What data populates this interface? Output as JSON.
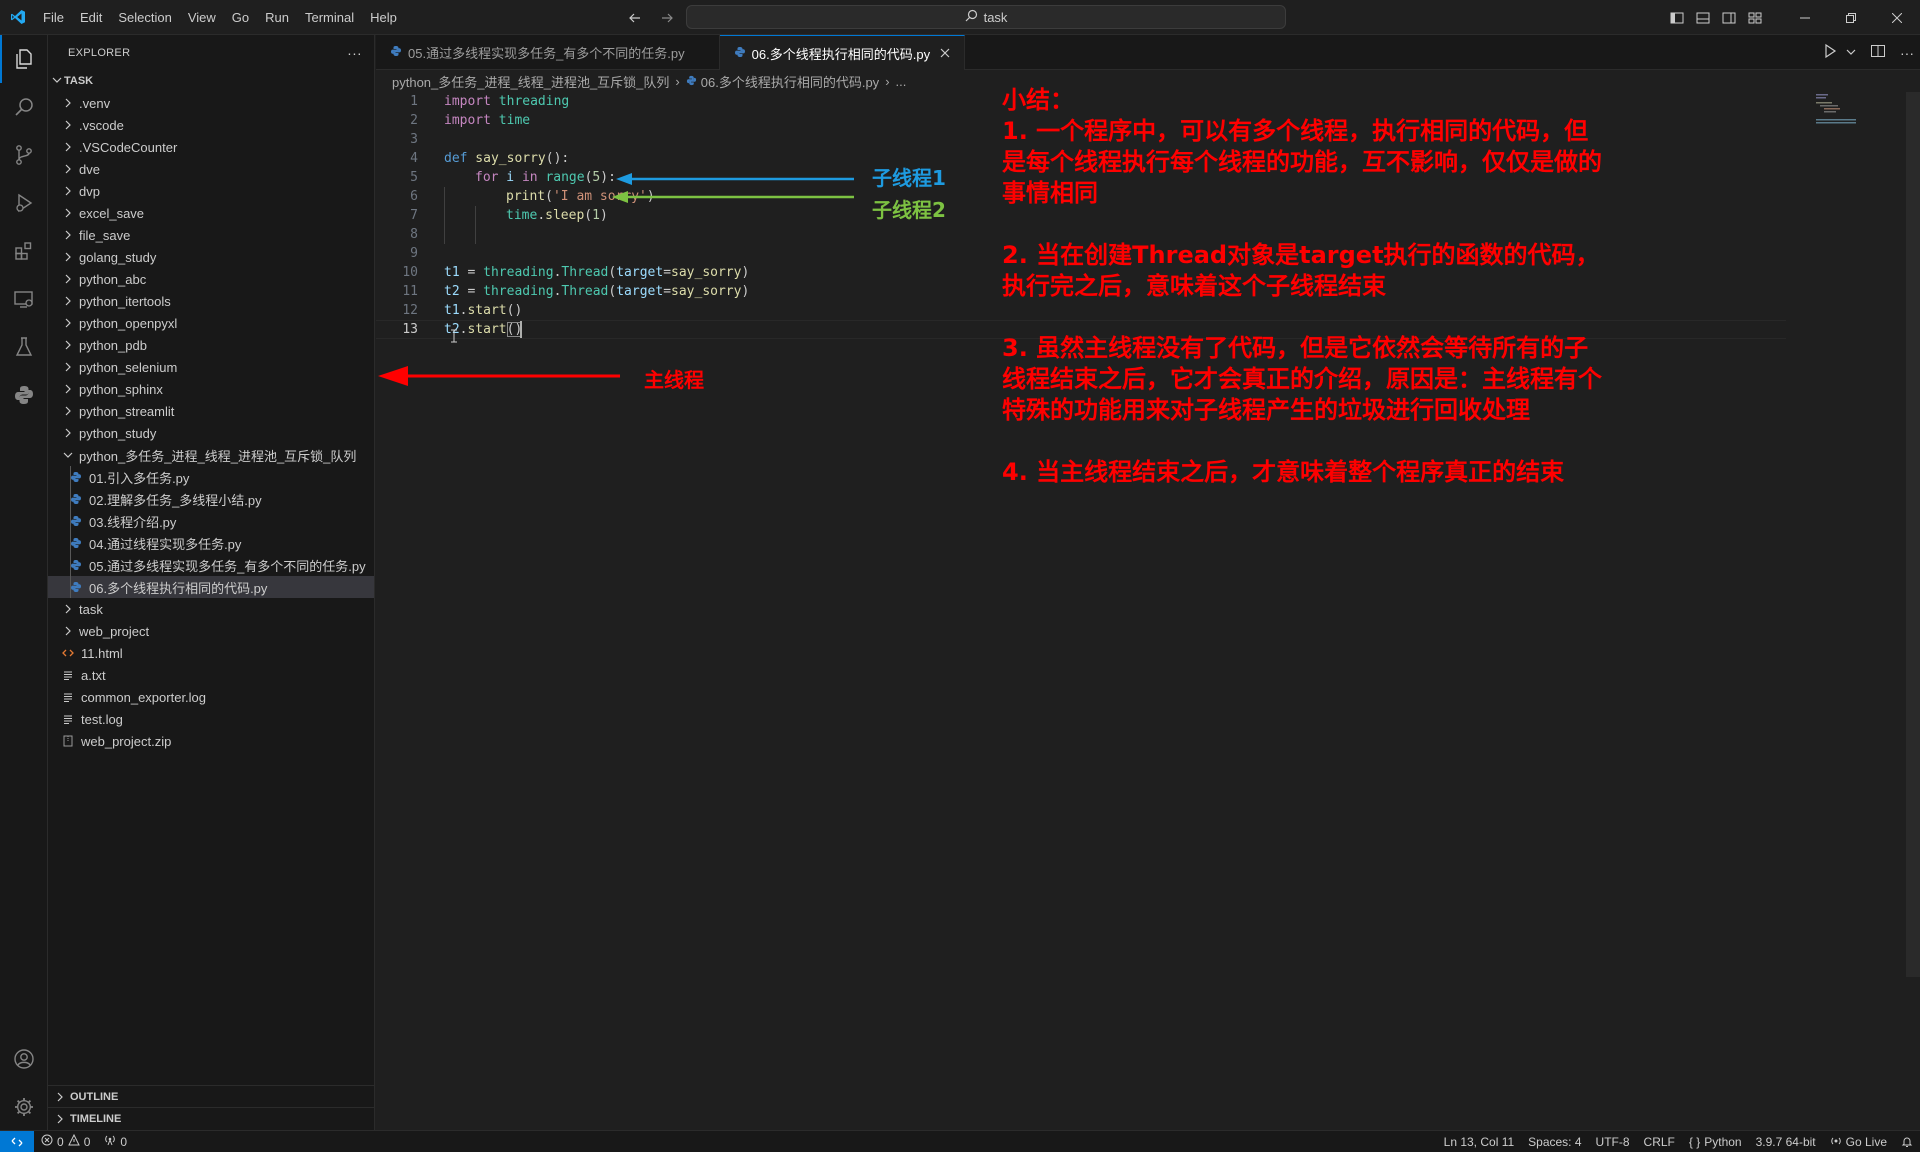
{
  "menu": [
    "File",
    "Edit",
    "Selection",
    "View",
    "Go",
    "Run",
    "Terminal",
    "Help"
  ],
  "search": {
    "text": "task"
  },
  "explorer": {
    "title": "EXPLORER",
    "more": "···",
    "folder": "TASK",
    "items": [
      {
        "label": ".venv",
        "kind": "folder"
      },
      {
        "label": ".vscode",
        "kind": "folder"
      },
      {
        "label": ".VSCodeCounter",
        "kind": "folder"
      },
      {
        "label": "dve",
        "kind": "folder"
      },
      {
        "label": "dvp",
        "kind": "folder"
      },
      {
        "label": "excel_save",
        "kind": "folder"
      },
      {
        "label": "file_save",
        "kind": "folder"
      },
      {
        "label": "golang_study",
        "kind": "folder"
      },
      {
        "label": "python_abc",
        "kind": "folder"
      },
      {
        "label": "python_itertools",
        "kind": "folder"
      },
      {
        "label": "python_openpyxl",
        "kind": "folder"
      },
      {
        "label": "python_pdb",
        "kind": "folder"
      },
      {
        "label": "python_selenium",
        "kind": "folder"
      },
      {
        "label": "python_sphinx",
        "kind": "folder"
      },
      {
        "label": "python_streamlit",
        "kind": "folder"
      },
      {
        "label": "python_study",
        "kind": "folder"
      },
      {
        "label": "python_多任务_进程_线程_进程池_互斥锁_队列",
        "kind": "open-folder"
      }
    ],
    "children": [
      "01.引入多任务.py",
      "02.理解多任务_多线程小结.py",
      "03.线程介绍.py",
      "04.通过线程实现多任务.py",
      "05.通过多线程实现多任务_有多个不同的任务.py",
      "06.多个线程执行相同的代码.py"
    ],
    "after": [
      {
        "label": "task",
        "kind": "folder"
      },
      {
        "label": "web_project",
        "kind": "folder"
      },
      {
        "label": "11.html",
        "kind": "html"
      },
      {
        "label": "a.txt",
        "kind": "text"
      },
      {
        "label": "common_exporter.log",
        "kind": "text"
      },
      {
        "label": "test.log",
        "kind": "text"
      },
      {
        "label": "web_project.zip",
        "kind": "zip"
      }
    ],
    "outline": "OUTLINE",
    "timeline": "TIMELINE"
  },
  "tabs": [
    {
      "label": "05.通过多线程实现多任务_有多个不同的任务.py",
      "active": false
    },
    {
      "label": "06.多个线程执行相同的代码.py",
      "active": true
    }
  ],
  "breadcrumb": {
    "folder": "python_多任务_进程_线程_进程池_互斥锁_队列",
    "file": "06.多个线程执行相同的代码.py",
    "more": "..."
  },
  "code": {
    "line_numbers": [
      "1",
      "2",
      "3",
      "4",
      "5",
      "6",
      "7",
      "8",
      "9",
      "10",
      "11",
      "12",
      "13"
    ],
    "lines": {
      "l1a": "import",
      "l1b": " threading",
      "l2a": "import",
      "l2b": " time",
      "l4a": "def",
      "l4b": " say_sorry",
      "l4c": "():",
      "l5a": "for",
      "l5b": " i ",
      "l5c": "in",
      "l5d": " range",
      "l5e": "(",
      "l5f": "5",
      "l5g": "):",
      "l6a": "print",
      "l6b": "(",
      "l6c": "'I am sorry'",
      "l6d": ")",
      "l7a": "time",
      "l7b": ".",
      "l7c": "sleep",
      "l7d": "(",
      "l7e": "1",
      "l7f": ")",
      "l10a": "t1",
      "l10b": " = ",
      "l10c": "threading",
      "l10d": ".",
      "l10e": "Thread",
      "l10f": "(",
      "l10g": "target",
      "l10h": "=",
      "l10i": "say_sorry",
      "l10j": ")",
      "l11a": "t2",
      "l11b": " = ",
      "l11c": "threading",
      "l11d": ".",
      "l11e": "Thread",
      "l11f": "(",
      "l11g": "target",
      "l11h": "=",
      "l11i": "say_sorry",
      "l11j": ")",
      "l12a": "t1",
      "l12b": ".",
      "l12c": "start",
      "l12d": "()",
      "l13a": "t2",
      "l13b": ".",
      "l13c": "start",
      "l13d": "()"
    }
  },
  "annotations": {
    "sub1": "子线程1",
    "sub2": "子线程2",
    "main": "主线程",
    "summary": [
      "小结：",
      "  1. 一个程序中，可以有多个线程，执行相同的代码，但是每个线程执行每个线程的功能，互不影响，仅仅是做的事情相同",
      "  2. 当在创建Thread对象是target执行的函数的代码，执行完之后，意味着这个子线程结束",
      "  3. 虽然主线程没有了代码，但是它依然会等待所有的子线程结束之后，它才会真正的介绍，原因是：主线程有个特殊的功能用来对子线程产生的垃圾进行回收处理",
      "  4. 当主线程结束之后，才意味着整个程序真正的结束"
    ],
    "colors": {
      "blue": "#1e9be0",
      "green": "#7dc242",
      "red": "#ff0000"
    }
  },
  "status": {
    "errors": "0",
    "warnings": "0",
    "ports": "0",
    "position": "Ln 13, Col 11",
    "spaces": "Spaces: 4",
    "encoding": "UTF-8",
    "eol": "CRLF",
    "language": "Python",
    "interpreter": "3.9.7 64-bit",
    "golive": "Go Live"
  }
}
